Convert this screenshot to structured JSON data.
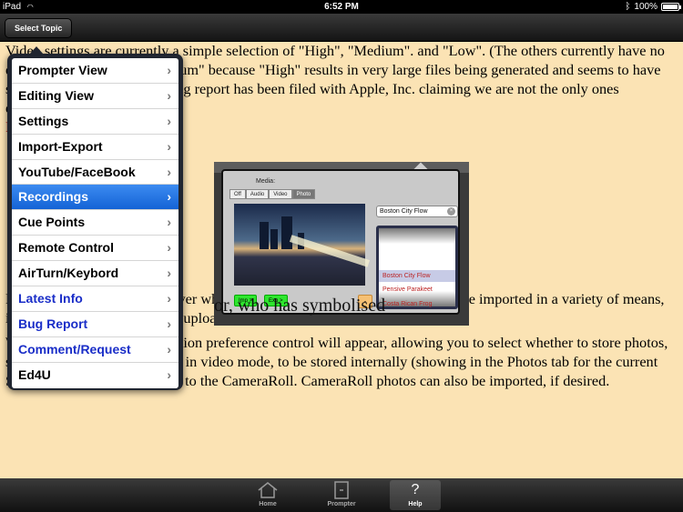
{
  "status": {
    "carrier": "iPad",
    "time": "6:52 PM",
    "battery": "100%"
  },
  "toolbar": {
    "topic_button": "Select Topic"
  },
  "content": {
    "para1": "Video settings are currently a simple selection of \"High\", \"Medium\". and \"Low\". (The others currently have no effect) we recommend \"Medium\" because \"High\" results in very large files being generated and seems to have some issues with audio. (A bug report has been filed with Apple, Inc. claiming we are not the only ones experiencing this.)",
    "heading": "P",
    "para2": "Photos will show in the popover when the Photos tab is selected. Photos can be imported in a variety of means, including outgoing email and uploads to FaceBook.",
    "para3": "When using an iPad2, a selection preference control will appear, allowing you to select whether to store photos, snapped from the iPad2 when in video mode, to be stored internally (showing in the Photos tab for the current Script selection) or externally to the CameraRoll. CameraRoll photos can also be imported, if desired."
  },
  "screenshot": {
    "media_label": "Media:",
    "segments": [
      "Off",
      "Audio",
      "Video",
      "Photo"
    ],
    "selected_segment": "Photo",
    "search_value": "Boston City Flow",
    "picker_items": [
      "Boston City Flow",
      "Pensive Parakeet",
      "Costa Rican Frog"
    ],
    "imp_label": "Imp >",
    "exp_label": "Exp >",
    "minus_label": "-",
    "big_text": "or, who has symbolised"
  },
  "menu": {
    "items": [
      {
        "label": "Prompter View",
        "blue": false,
        "active": false
      },
      {
        "label": "Editing View",
        "blue": false,
        "active": false
      },
      {
        "label": "Settings",
        "blue": false,
        "active": false
      },
      {
        "label": "Import-Export",
        "blue": false,
        "active": false
      },
      {
        "label": "YouTube/FaceBook",
        "blue": false,
        "active": false
      },
      {
        "label": "Recordings",
        "blue": false,
        "active": true
      },
      {
        "label": "Cue Points",
        "blue": false,
        "active": false
      },
      {
        "label": "Remote Control",
        "blue": false,
        "active": false
      },
      {
        "label": "AirTurn/Keybord",
        "blue": false,
        "active": false
      },
      {
        "label": "Latest Info",
        "blue": true,
        "active": false
      },
      {
        "label": "Bug Report",
        "blue": true,
        "active": false
      },
      {
        "label": "Comment/Request",
        "blue": true,
        "active": false
      },
      {
        "label": "Ed4U",
        "blue": false,
        "active": false
      }
    ]
  },
  "tabbar": {
    "tabs": [
      {
        "label": "Home",
        "icon": "home-icon"
      },
      {
        "label": "Prompter",
        "icon": "prompter-icon"
      },
      {
        "label": "Help",
        "icon": "help-icon"
      }
    ],
    "active": "Help"
  },
  "colors": {
    "page_bg": "#fbe3b4",
    "active_item": "#1a6ae0",
    "link_blue": "#1a2ec8"
  }
}
